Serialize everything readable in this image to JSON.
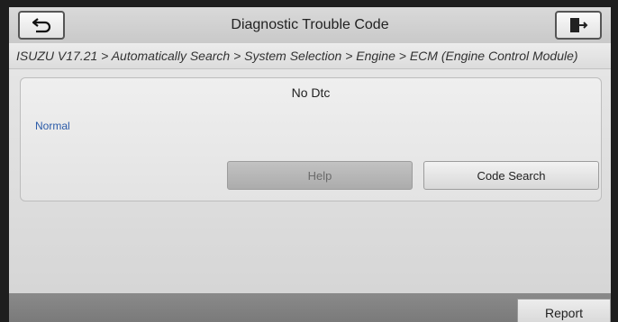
{
  "header": {
    "title": "Diagnostic Trouble Code",
    "back_icon": "back-arrow-icon",
    "exit_icon": "exit-door-icon"
  },
  "breadcrumb": {
    "text": "ISUZU V17.21 > Automatically Search > System Selection > Engine > ECM (Engine Control Module)"
  },
  "panel": {
    "message": "No Dtc",
    "status": "Normal",
    "buttons": {
      "help": "Help",
      "code_search": "Code Search"
    }
  },
  "footer": {
    "report": "Report"
  },
  "colors": {
    "status_text": "#2a5aa8",
    "disabled_button": "#b5b5b5"
  }
}
